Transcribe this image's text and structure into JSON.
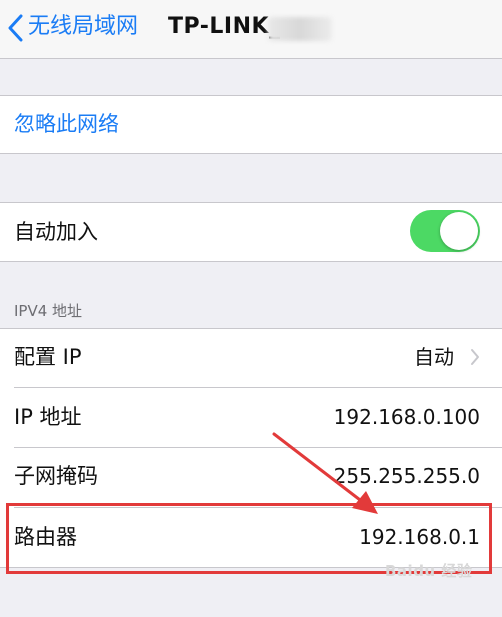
{
  "nav": {
    "back_label": "无线局域网",
    "title": "TP-LINK_"
  },
  "forget": {
    "label": "忽略此网络"
  },
  "auto_join": {
    "label": "自动加入",
    "enabled": true
  },
  "ipv4": {
    "header": "IPV4 地址",
    "rows": [
      {
        "label": "配置 IP",
        "value": "自动"
      },
      {
        "label": "IP 地址",
        "value": "192.168.0.100"
      },
      {
        "label": "子网掩码",
        "value": "255.255.255.0"
      },
      {
        "label": "路由器",
        "value": "192.168.0.1"
      }
    ]
  },
  "colors": {
    "accent": "#1a7cf5",
    "toggle_on": "#4cd964",
    "highlight": "#e23a3a"
  },
  "watermark": "Baidu 经验"
}
